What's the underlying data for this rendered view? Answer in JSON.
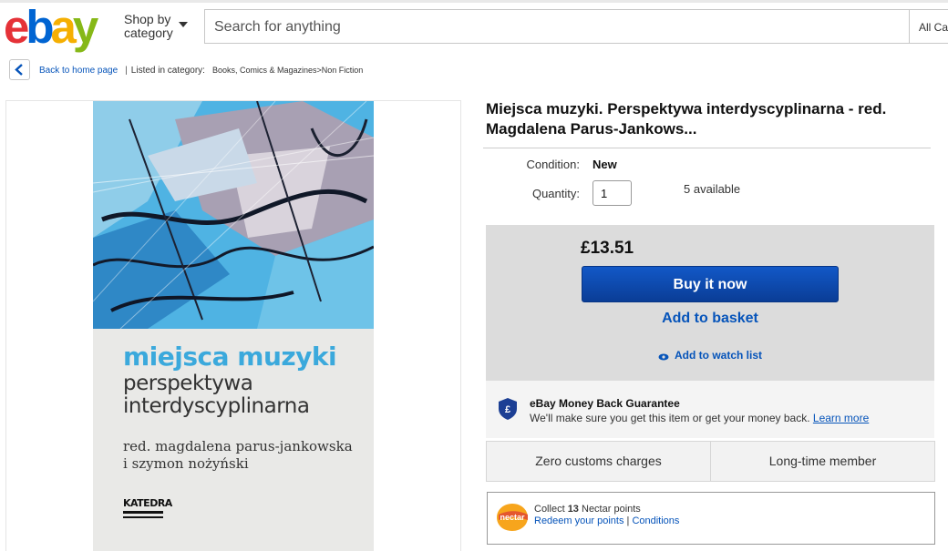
{
  "header": {
    "logo": [
      "e",
      "b",
      "a",
      "y"
    ],
    "logo_colors": [
      "#e53238",
      "#0064d2",
      "#f5af02",
      "#86b817"
    ],
    "shop_by": "Shop by",
    "category": "category",
    "search_placeholder": "Search for anything",
    "all_categories": "All Categories"
  },
  "breadcrumb": {
    "back": "Back to home page",
    "listed": "Listed in category:",
    "category_path": "Books, Comics & Magazines>Non Fiction"
  },
  "cover": {
    "title": "miejsca muzyki",
    "subtitle_line1": "perspektywa",
    "subtitle_line2": "interdyscyplinarna",
    "authors_line1": "red. magdalena parus-jankowska",
    "authors_line2": "i szymon nożyński",
    "publisher": "KATEDRA"
  },
  "item": {
    "title": "Miejsca muzyki. Perspektywa interdyscyplinarna - red. Magdalena Parus-Jankows...",
    "condition_label": "Condition:",
    "condition_value": "New",
    "quantity_label": "Quantity:",
    "quantity_value": "1",
    "available": "5 available",
    "price": "£13.51",
    "buy_now": "Buy it now",
    "add_to_basket": "Add to basket",
    "add_to_watch": "Add to watch list"
  },
  "guarantee": {
    "title": "eBay Money Back Guarantee",
    "text": "We'll make sure you get this item or get your money back.",
    "learn_more": "Learn more"
  },
  "features": [
    "Zero customs charges",
    "Long-time member"
  ],
  "nectar": {
    "logo": "nectar",
    "collect_prefix": "Collect",
    "points": "13",
    "collect_suffix": "Nectar points",
    "redeem": "Redeem your points",
    "divider": "|",
    "conditions": "Conditions"
  },
  "colors": {
    "link": "#0654ba",
    "buy_button": "#0a4fb5",
    "buy_box": "#dcdcdc"
  }
}
